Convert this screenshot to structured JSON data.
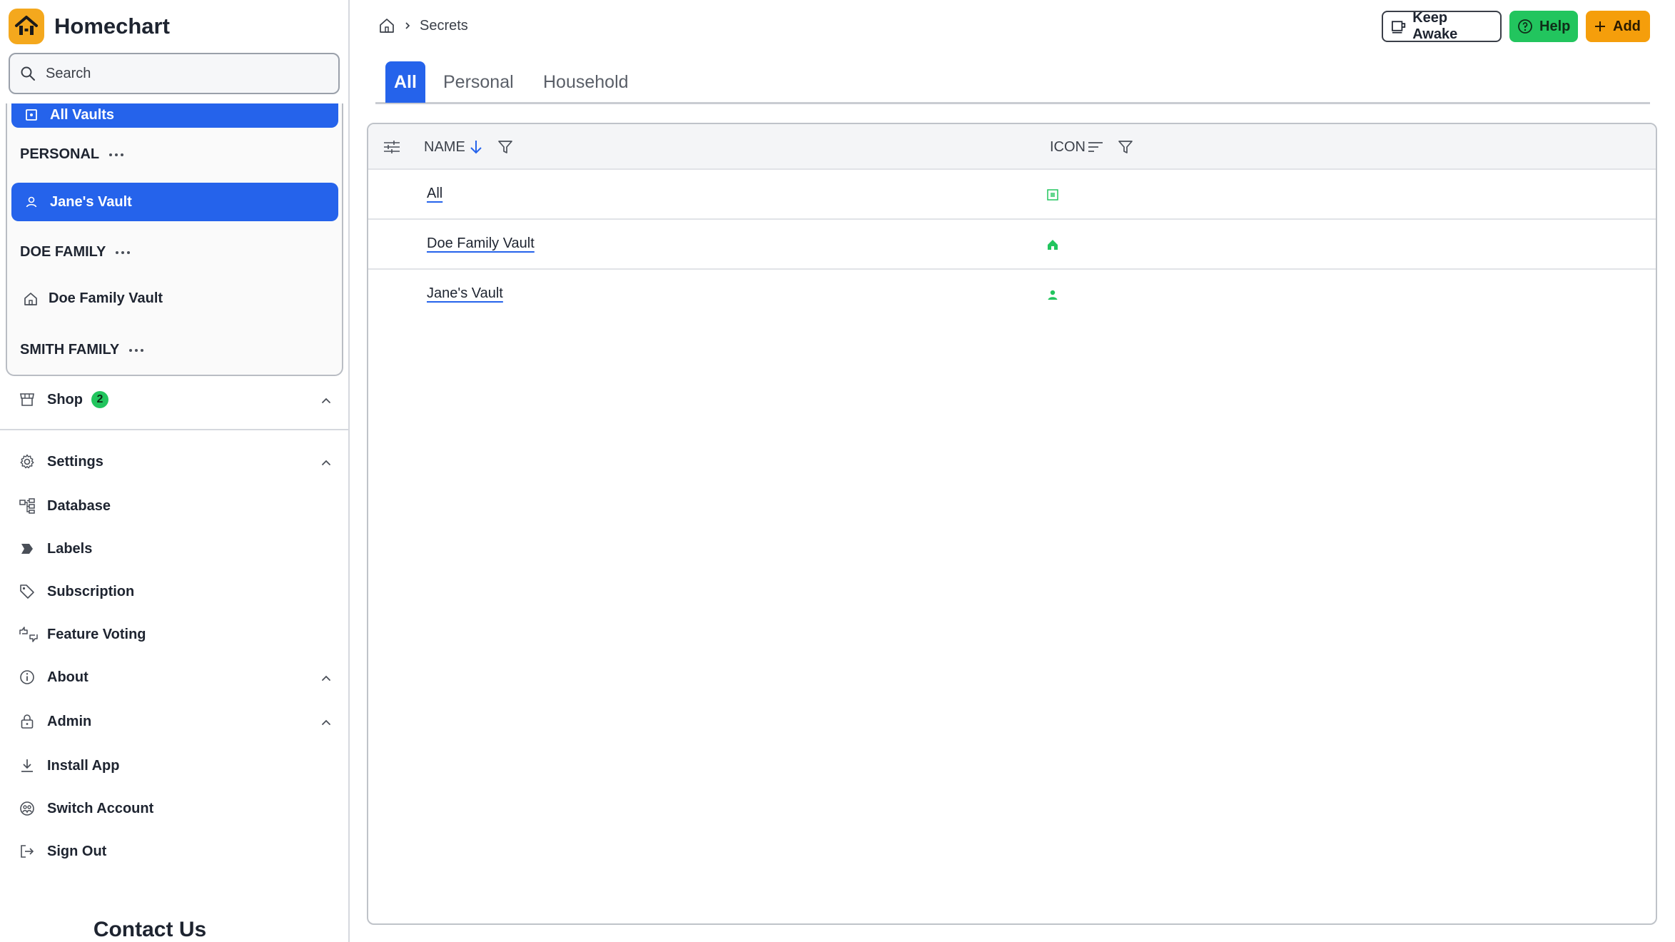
{
  "app": {
    "title": "Homechart"
  },
  "search": {
    "placeholder": "Search"
  },
  "vaults": {
    "all_label": "All Vaults",
    "groups": [
      {
        "name": "PERSONAL",
        "items": [
          {
            "label": "Jane's Vault",
            "icon": "user-icon",
            "active": true
          }
        ]
      },
      {
        "name": "DOE FAMILY",
        "items": [
          {
            "label": "Doe Family Vault",
            "icon": "home-icon",
            "active": false
          }
        ]
      },
      {
        "name": "SMITH FAMILY",
        "items": []
      }
    ]
  },
  "nav": {
    "shop": {
      "label": "Shop",
      "badge": "2"
    },
    "settings": {
      "label": "Settings"
    },
    "items": [
      {
        "label": "Database",
        "icon": "database-icon"
      },
      {
        "label": "Labels",
        "icon": "label-icon"
      },
      {
        "label": "Subscription",
        "icon": "tag-icon"
      },
      {
        "label": "Feature Voting",
        "icon": "thumbs-icon"
      }
    ],
    "about": {
      "label": "About"
    },
    "admin": {
      "label": "Admin"
    },
    "install": {
      "label": "Install App"
    },
    "switch": {
      "label": "Switch Account"
    },
    "signout": {
      "label": "Sign Out"
    }
  },
  "contact": {
    "label": "Contact Us"
  },
  "breadcrumb": {
    "current": "Secrets"
  },
  "header_buttons": {
    "keep_awake": "Keep Awake",
    "help": "Help",
    "add": "Add"
  },
  "tabs": [
    {
      "label": "All",
      "active": true
    },
    {
      "label": "Personal",
      "active": false
    },
    {
      "label": "Household",
      "active": false
    }
  ],
  "table": {
    "columns": {
      "name": "NAME",
      "icon": "ICON"
    },
    "sort": {
      "column": "NAME",
      "direction": "descending"
    },
    "rows": [
      {
        "name": "All",
        "icon": "grid-icon"
      },
      {
        "name": "Doe Family Vault",
        "icon": "home-icon"
      },
      {
        "name": "Jane's Vault",
        "icon": "user-icon"
      }
    ]
  },
  "colors": {
    "accent": "#2563eb",
    "help": "#22c55e",
    "add": "#f59e0b",
    "logo": "#f4a81d"
  }
}
